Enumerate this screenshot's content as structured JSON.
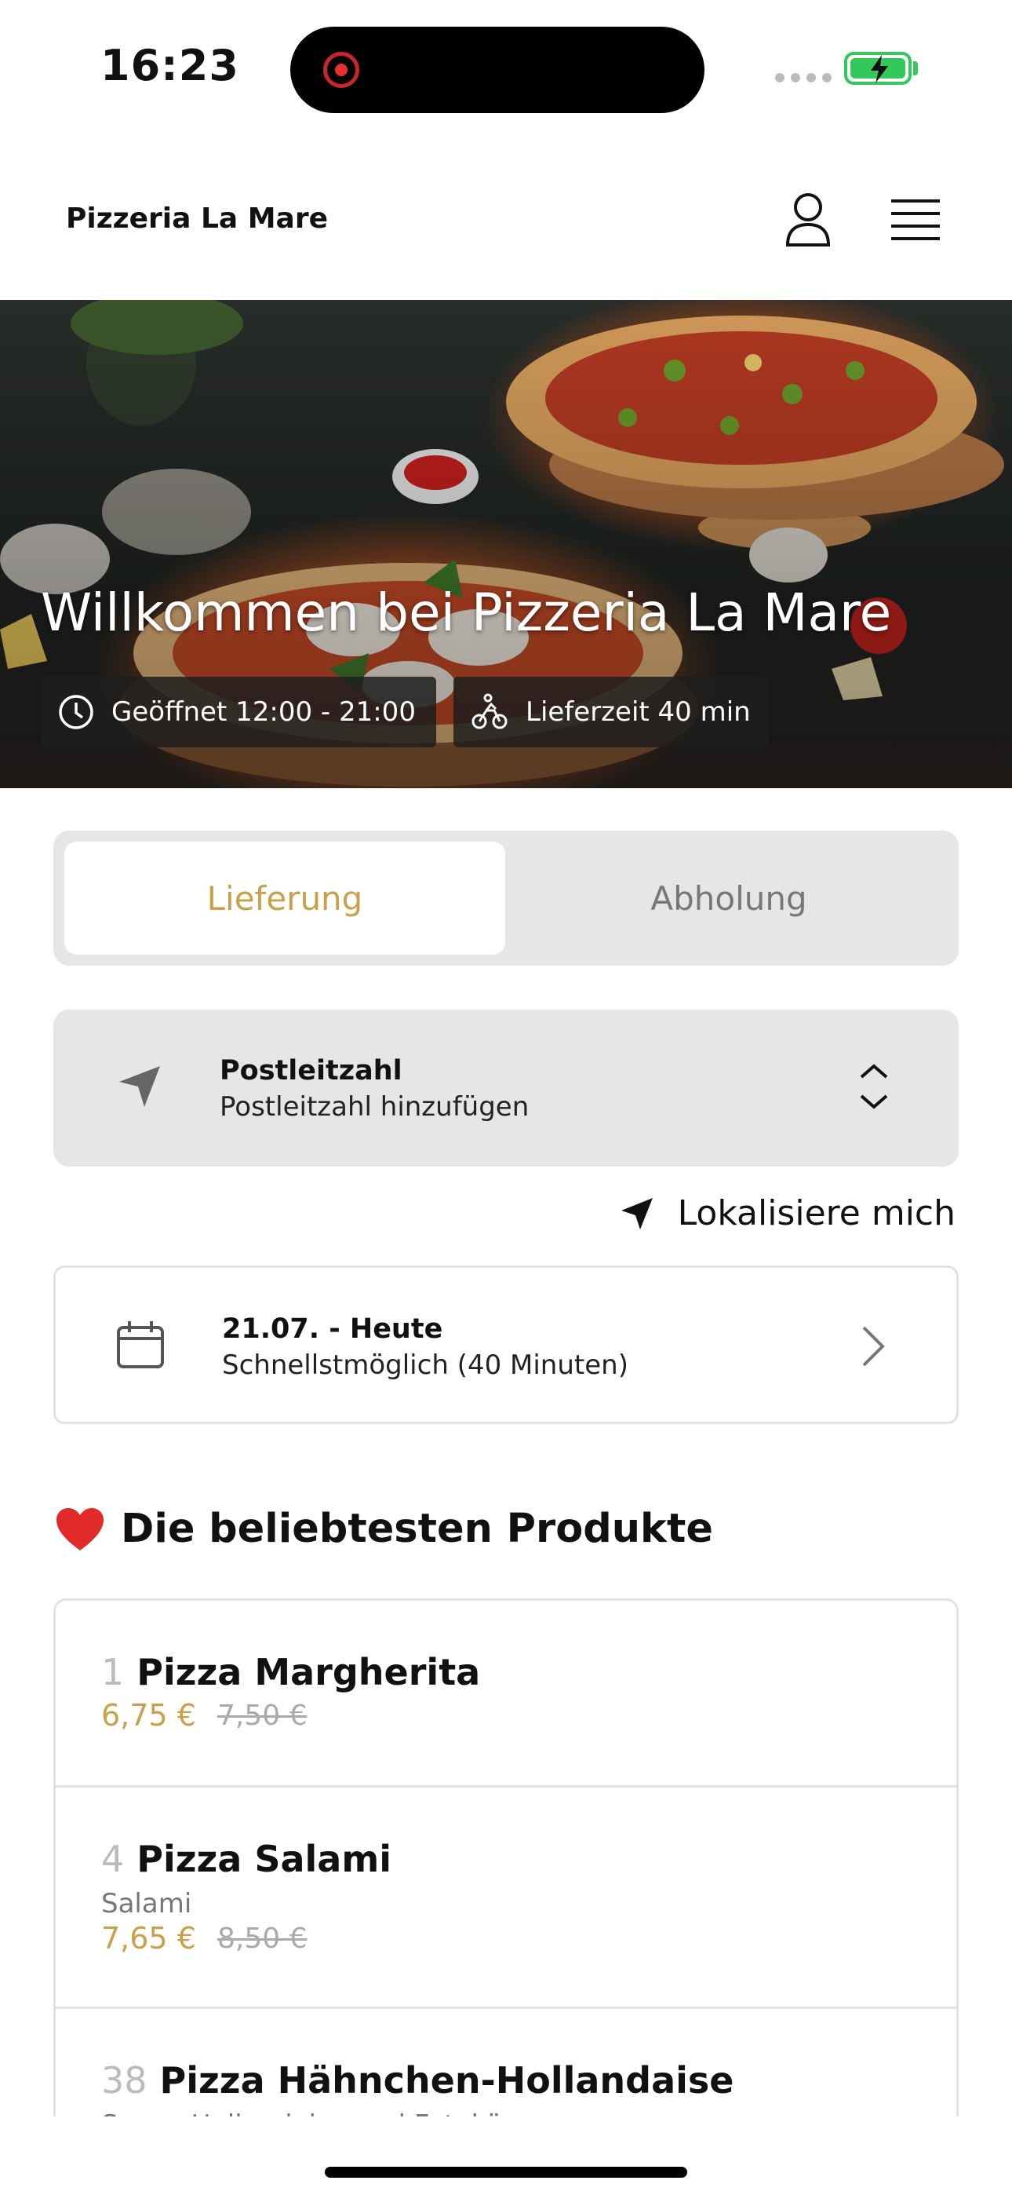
{
  "status_bar": {
    "time": "16:23"
  },
  "header": {
    "brand": "Pizzeria La Mare"
  },
  "hero": {
    "title": "Willkommen bei Pizzeria La Mare",
    "open_hours": "Geöffnet 12:00 - 21:00",
    "delivery_time": "Lieferzeit 40 min"
  },
  "mode_toggle": {
    "delivery": "Lieferung",
    "pickup": "Abholung",
    "selected": "Lieferung"
  },
  "postcode": {
    "label": "Postleitzahl",
    "placeholder": "Postleitzahl hinzufügen"
  },
  "locate": {
    "label": "Lokalisiere mich"
  },
  "date": {
    "title": "21.07. - Heute",
    "subtitle": "Schnellstmöglich (40 Minuten)"
  },
  "popular": {
    "title": "Die beliebtesten Produkte",
    "products": [
      {
        "number": "1",
        "name": "Pizza Margherita",
        "description": "",
        "price": "6,75 €",
        "old_price": "7,50 €"
      },
      {
        "number": "4",
        "name": "Pizza Salami",
        "description": "Salami",
        "price": "7,65 €",
        "old_price": "8,50 €"
      },
      {
        "number": "38",
        "name": "Pizza Hähnchen-Hollandaise",
        "description": "Sauce Hollandaise und Fetakäse",
        "price": "",
        "old_price": ""
      }
    ]
  },
  "colors": {
    "accent": "#c6a24a",
    "battery": "#34c759",
    "recording": "#e5322f"
  }
}
